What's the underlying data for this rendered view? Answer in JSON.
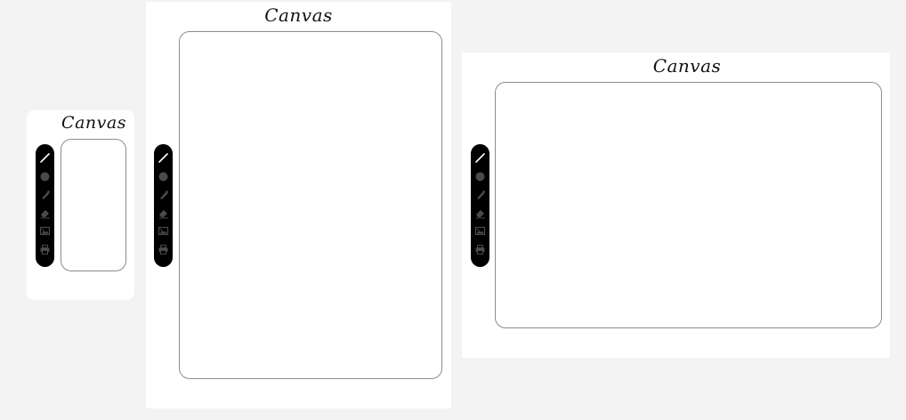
{
  "panels": [
    {
      "id": "small",
      "title": "Canvas"
    },
    {
      "id": "tall",
      "title": "Canvas"
    },
    {
      "id": "wide",
      "title": "Canvas"
    }
  ],
  "toolbar": {
    "tools": [
      {
        "name": "pen-tool",
        "icon": "pen-icon",
        "active": true
      },
      {
        "name": "color-tool",
        "icon": "circle-icon"
      },
      {
        "name": "brush-tool",
        "icon": "brush-icon"
      },
      {
        "name": "eraser-tool",
        "icon": "eraser-icon"
      },
      {
        "name": "image-tool",
        "icon": "image-icon"
      },
      {
        "name": "print-tool",
        "icon": "print-icon"
      }
    ]
  },
  "colors": {
    "background": "#f3f3f3",
    "panel": "#ffffff",
    "toolbar": "#000000",
    "active_icon": "#ffffff",
    "inactive_icon": "#4a4a4a",
    "canvas_border": "#8c8c8c"
  }
}
